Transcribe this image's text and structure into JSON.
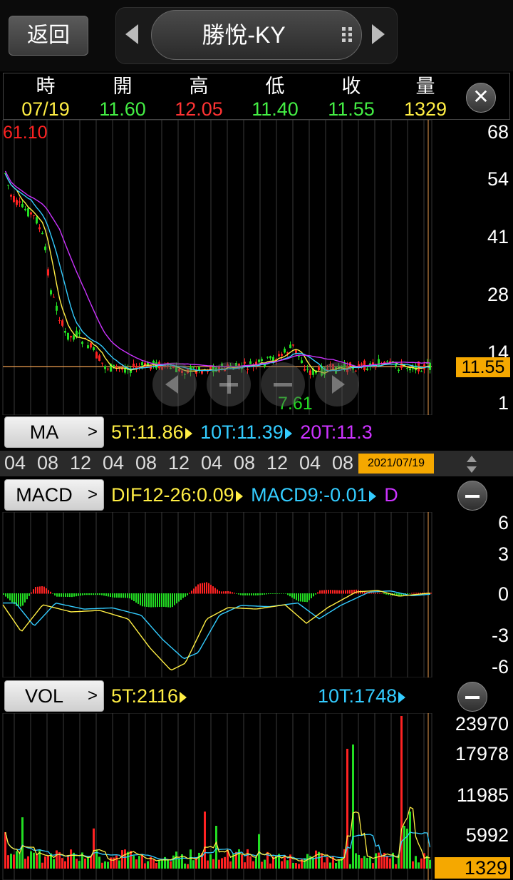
{
  "header": {
    "back_label": "返回",
    "title": "勝悅-KY"
  },
  "quote": {
    "columns": [
      {
        "label": "時",
        "value": "07/19",
        "color": "#ffee44"
      },
      {
        "label": "開",
        "value": "11.60",
        "color": "#44ee44"
      },
      {
        "label": "高",
        "value": "12.05",
        "color": "#ff3333"
      },
      {
        "label": "低",
        "value": "11.40",
        "color": "#44ee44"
      },
      {
        "label": "收",
        "value": "11.55",
        "color": "#44ee44"
      },
      {
        "label": "量",
        "value": "1329",
        "color": "#ffee44"
      }
    ],
    "close_symbol": "✕"
  },
  "price_panel": {
    "max_label": "61.10",
    "min_label": "7.61",
    "y_ticks": [
      "68",
      "54",
      "41",
      "28",
      "14",
      "1"
    ],
    "current_price": "11.55",
    "indicator_label": "MA",
    "ma": [
      {
        "text": "5T:11.86",
        "color": "#ffee44"
      },
      {
        "text": "10T:11.39",
        "color": "#33ccff"
      },
      {
        "text": "20T:11.3",
        "color": "#cc33ff"
      }
    ]
  },
  "time_axis": {
    "ticks": [
      "04",
      "08",
      "12",
      "04",
      "08",
      "12",
      "04",
      "08",
      "12",
      "04",
      "08"
    ],
    "current_date": "2021/07/19"
  },
  "macd_panel": {
    "indicator_label": "MACD",
    "dif": "DIF12-26:0.09",
    "macd": "MACD9:-0.01",
    "osc_partial": "D",
    "y_ticks": [
      "6",
      "3",
      "0",
      "-3",
      "-6"
    ]
  },
  "vol_panel": {
    "indicator_label": "VOL",
    "ma5": "5T:2116",
    "ma10": "10T:1748",
    "y_ticks": [
      "23970",
      "17978",
      "11985",
      "5992"
    ],
    "current_volume": "1329"
  },
  "colors": {
    "up": "#ff2222",
    "down": "#22dd22",
    "ma5": "#ffee44",
    "ma10": "#33ccff",
    "ma20": "#cc33ff",
    "price_line": "#f0a050",
    "badge": "#f5a800"
  },
  "icons": [
    "left-arrow-icon",
    "right-arrow-icon",
    "grid-menu-icon",
    "close-icon",
    "chevron-right-icon",
    "minus-icon",
    "sort-arrows-icon",
    "pan-left-icon",
    "zoom-in-icon",
    "zoom-out-icon",
    "pan-right-icon"
  ]
}
